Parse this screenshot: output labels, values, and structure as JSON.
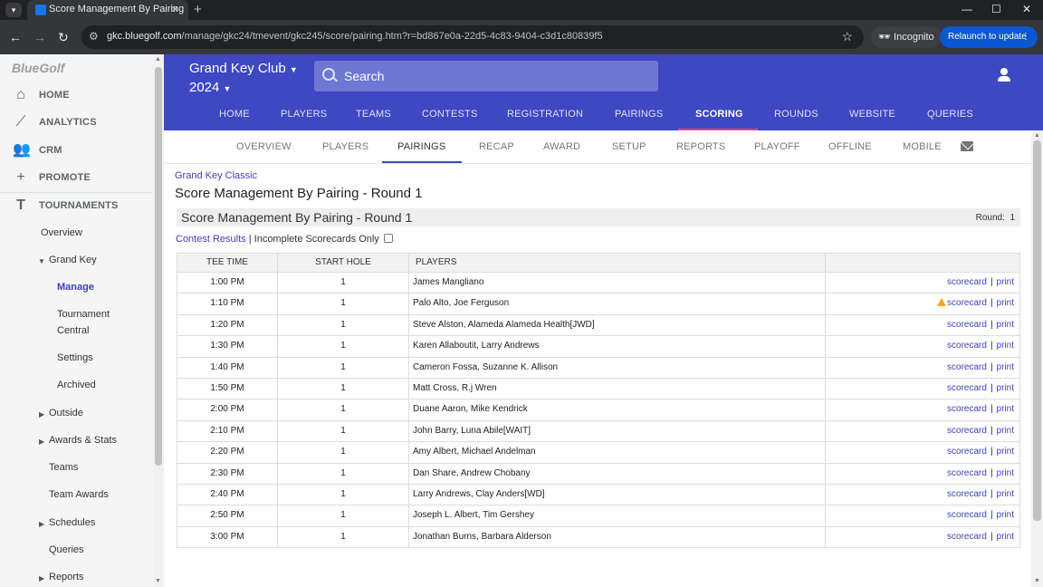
{
  "browser": {
    "tab_title": "Score Management By Pairing",
    "url_host": "gkc.bluegolf.com",
    "url_path": "/manage/gkc24/tmevent/gkc245/score/pairing.htm?r=bd867e0a-22d5-4c83-9404-c3d1c80839f5",
    "incognito_label": "Incognito",
    "relaunch_label": "Relaunch to update"
  },
  "sidebar": {
    "logo": "BlueGolf",
    "main_items": [
      {
        "label": "HOME",
        "icon": "home-icon"
      },
      {
        "label": "ANALYTICS",
        "icon": "analytics-icon"
      },
      {
        "label": "CRM",
        "icon": "people-icon"
      },
      {
        "label": "PROMOTE",
        "icon": "plus-icon"
      },
      {
        "label": "TOURNAMENTS",
        "icon": "tournaments-icon"
      }
    ],
    "sub_items": {
      "overview": "Overview",
      "grand_key": "Grand Key",
      "manage": "Manage",
      "tournament_central_1": "Tournament",
      "tournament_central_2": "Central",
      "settings": "Settings",
      "archived": "Archived",
      "outside": "Outside",
      "awards_stats": "Awards & Stats",
      "teams": "Teams",
      "team_awards": "Team Awards",
      "schedules": "Schedules",
      "queries": "Queries",
      "reports": "Reports"
    }
  },
  "header": {
    "club": "Grand Key Club",
    "year": "2024",
    "search_placeholder": "Search",
    "nav": [
      "HOME",
      "PLAYERS",
      "TEAMS",
      "CONTESTS",
      "REGISTRATION",
      "PAIRINGS",
      "SCORING",
      "ROUNDS",
      "WEBSITE",
      "QUERIES"
    ],
    "active_nav": "SCORING"
  },
  "subnav": {
    "items": [
      "OVERVIEW",
      "PLAYERS",
      "PAIRINGS",
      "RECAP",
      "AWARD",
      "SETUP",
      "REPORTS",
      "PLAYOFF",
      "OFFLINE",
      "MOBILE"
    ],
    "active": "PAIRINGS"
  },
  "main": {
    "breadcrumb": "Grand Key Classic",
    "title": "Score Management By Pairing - Round 1",
    "round_bar_title": "Score Management By Pairing - Round 1",
    "round_label": "Round:",
    "round_value": "1",
    "contest_results": "Contest Results",
    "link_separator": "|",
    "incomplete_label": "Incomplete Scorecards Only",
    "table": {
      "headers": [
        "TEE TIME",
        "START HOLE",
        "PLAYERS",
        ""
      ],
      "scorecard_label": "scorecard",
      "print_label": "print",
      "rows": [
        {
          "tee": "1:00 PM",
          "hole": "1",
          "players": "James Mangliano",
          "warn": false
        },
        {
          "tee": "1:10 PM",
          "hole": "1",
          "players": "Palo Alto, Joe Ferguson",
          "warn": true
        },
        {
          "tee": "1:20 PM",
          "hole": "1",
          "players": "Steve Alston, Alameda Alameda Health[JWD]",
          "warn": false
        },
        {
          "tee": "1:30 PM",
          "hole": "1",
          "players": "Karen Allaboutit, Larry Andrews",
          "warn": false
        },
        {
          "tee": "1:40 PM",
          "hole": "1",
          "players": "Cameron Fossa, Suzanne K. Allison",
          "warn": false
        },
        {
          "tee": "1:50 PM",
          "hole": "1",
          "players": "Matt Cross, R.j Wren",
          "warn": false
        },
        {
          "tee": "2:00 PM",
          "hole": "1",
          "players": "Duane Aaron, Mike Kendrick",
          "warn": false
        },
        {
          "tee": "2:10 PM",
          "hole": "1",
          "players": "John Barry, Luna Abile[WAIT]",
          "warn": false
        },
        {
          "tee": "2:20 PM",
          "hole": "1",
          "players": "Amy Albert, Michael Andelman",
          "warn": false
        },
        {
          "tee": "2:30 PM",
          "hole": "1",
          "players": "Dan Share, Andrew Chobany",
          "warn": false
        },
        {
          "tee": "2:40 PM",
          "hole": "1",
          "players": "Larry Andrews, Clay Anders[WD]",
          "warn": false
        },
        {
          "tee": "2:50 PM",
          "hole": "1",
          "players": "Joseph L. Albert, Tim Gershey",
          "warn": false
        },
        {
          "tee": "3:00 PM",
          "hole": "1",
          "players": "Jonathan Burns, Barbara Alderson",
          "warn": false
        }
      ]
    }
  },
  "colors": {
    "header_bg": "#3d48c2",
    "link": "#3b44b8",
    "active_underline": "#ff4081",
    "warning": "#f5a623"
  }
}
